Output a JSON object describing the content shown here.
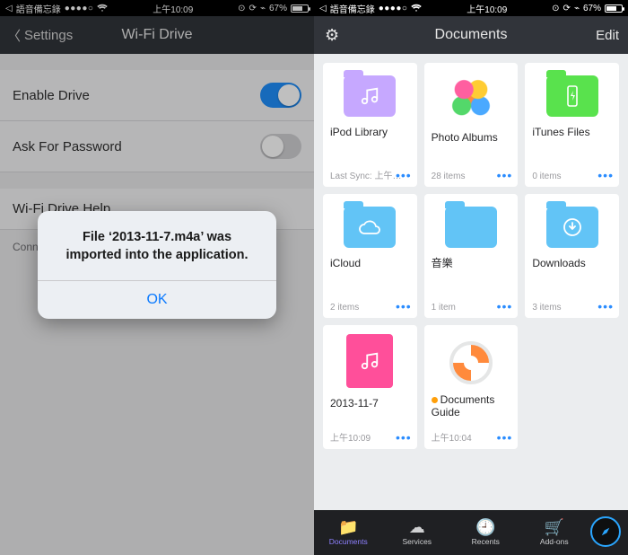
{
  "status": {
    "app_return": "語音備忘錄",
    "carrier_dots": "●●●●○",
    "wifi": "⚞",
    "time": "上午10:09",
    "alarm": "⏰",
    "lock": "⤿",
    "bt": "✱",
    "battery_pct": "67%"
  },
  "left": {
    "back_label": "Settings",
    "title": "Wi-Fi Drive",
    "rows": {
      "enable": "Enable Drive",
      "ask_pw": "Ask For Password",
      "help": "Wi-Fi Drive Help"
    },
    "help_text": "Connect … WebDAV app w…",
    "alert": {
      "message_l1": "File ‘2013-11-7.m4a’ was",
      "message_l2": "imported into the application.",
      "ok": "OK"
    }
  },
  "right": {
    "title": "Documents",
    "edit": "Edit",
    "items": [
      {
        "name": "iPod Library",
        "sub": "Last Sync: 上午…",
        "folder_color": "#c6a8ff",
        "icon": "music"
      },
      {
        "name": "Photo Albums",
        "sub": "28 items",
        "thumb": "albums"
      },
      {
        "name": "iTunes Files",
        "sub": "0 items",
        "folder_color": "#59e24d",
        "icon": "flash"
      },
      {
        "name": "iCloud",
        "sub": "2 items",
        "folder_color": "#62c4f6",
        "icon": "cloud"
      },
      {
        "name": "音樂",
        "sub": "1 item",
        "folder_color": "#62c4f6",
        "icon": "blank"
      },
      {
        "name": "Downloads",
        "sub": "3 items",
        "folder_color": "#62c4f6",
        "icon": "download"
      },
      {
        "name": "2013-11-7",
        "sub": "上午10:09",
        "thumb": "audio",
        "file_color": "#ff4f9a"
      },
      {
        "name": "Documents Guide",
        "sub": "上午10:04",
        "thumb": "guide",
        "dot": true
      }
    ],
    "tabs": [
      {
        "label": "Documents",
        "icon": "📁",
        "active": true
      },
      {
        "label": "Services",
        "icon": "☁",
        "active": false
      },
      {
        "label": "Recents",
        "icon": "🕘",
        "active": false
      },
      {
        "label": "Add-ons",
        "icon": "🛒",
        "active": false
      }
    ]
  }
}
